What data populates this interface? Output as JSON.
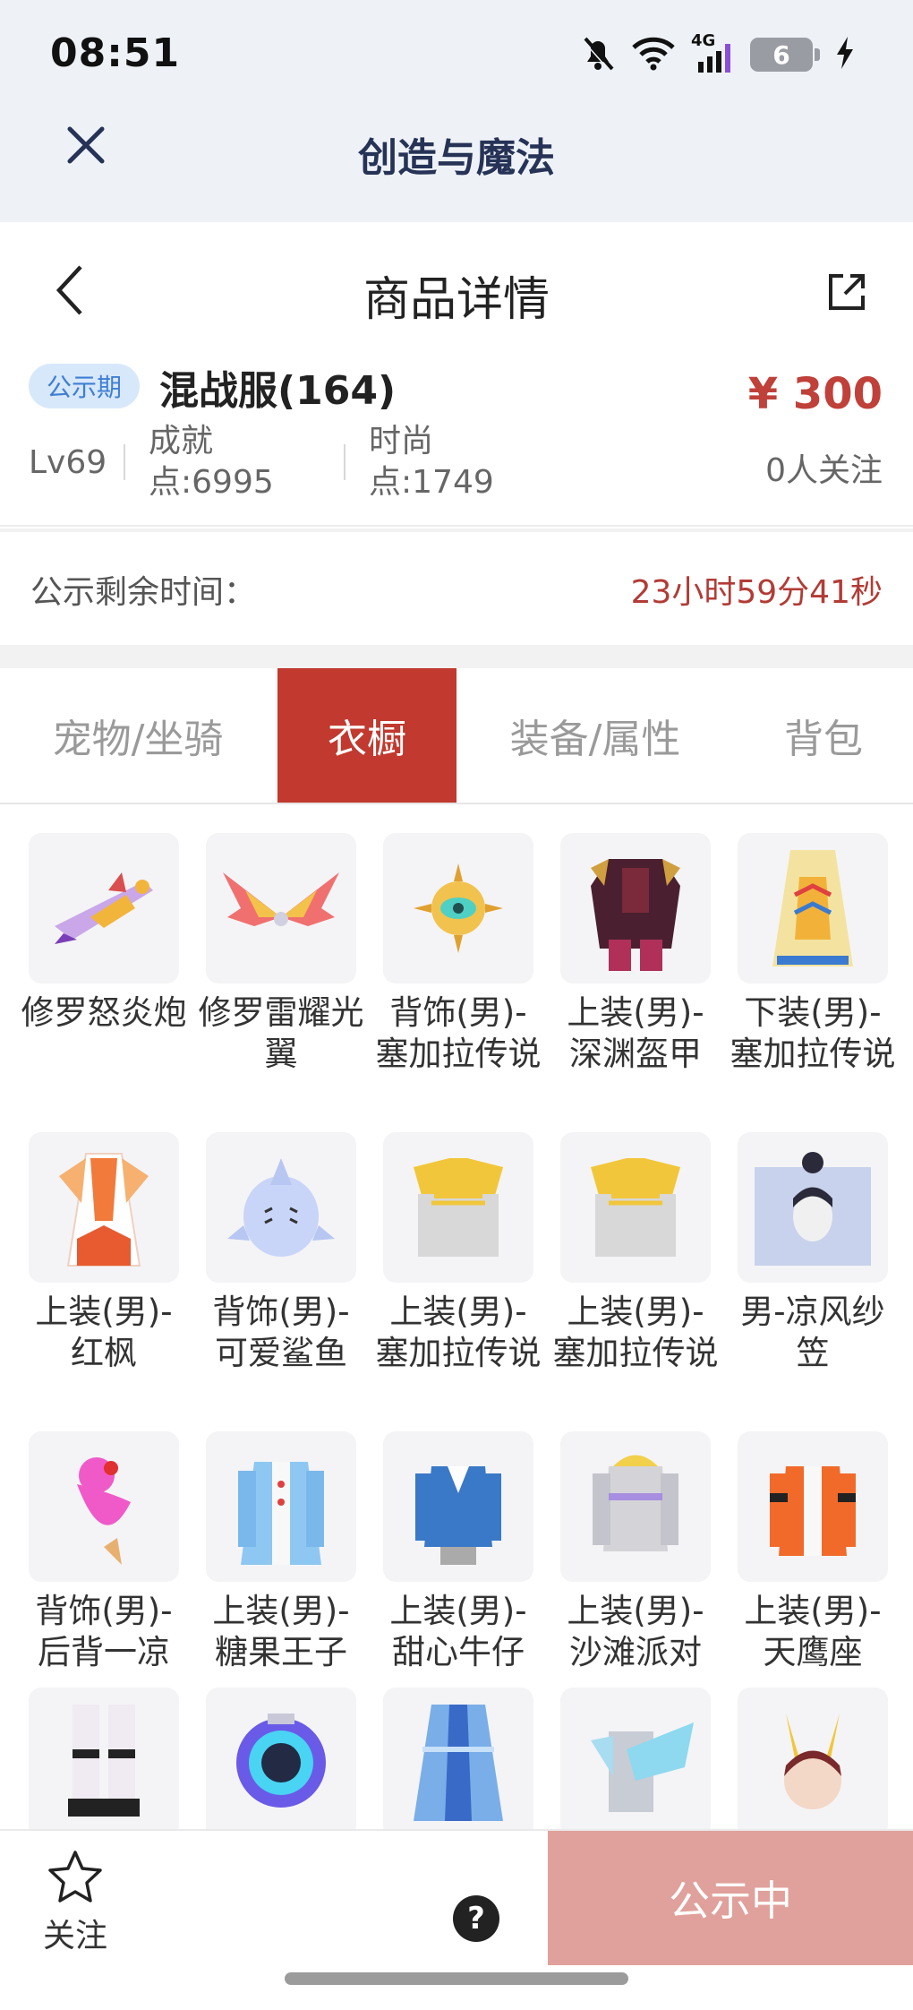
{
  "status_bar": {
    "time": "08:51",
    "network": "4G",
    "battery": "6"
  },
  "app_header": {
    "title": "创造与魔法"
  },
  "page_header": {
    "title": "商品详情"
  },
  "product": {
    "badge": "公示期",
    "name": "混战服(164)",
    "price": "¥ 300",
    "level": "Lv69",
    "achievement_label": "成就",
    "achievement_value": "点:6995",
    "fashion_label": "时尚",
    "fashion_value": "点:1749",
    "followers": "0人关注"
  },
  "timer": {
    "label": "公示剩余时间：",
    "value": "23小时59分41秒"
  },
  "tabs": [
    {
      "label": "宠物/坐骑",
      "active": false
    },
    {
      "label": "衣橱",
      "active": true
    },
    {
      "label": "装备/属性",
      "active": false
    },
    {
      "label": "背包",
      "active": false
    }
  ],
  "items": [
    {
      "label": "修罗怒炎炮",
      "icon": "cannon-icon"
    },
    {
      "label": "修罗雷耀光翼",
      "icon": "wings-icon"
    },
    {
      "label": "背饰(男)-塞加拉传说",
      "icon": "eye-ornament-icon"
    },
    {
      "label": "上装(男)-深渊盔甲",
      "icon": "armor-icon"
    },
    {
      "label": "下装(男)-塞加拉传说",
      "icon": "robe-icon"
    },
    {
      "label": "上装(男)-红枫",
      "icon": "red-robe-icon"
    },
    {
      "label": "背饰(男)-可爱鲨鱼",
      "icon": "shark-icon"
    },
    {
      "label": "上装(男)-塞加拉传说",
      "icon": "gold-shirt-icon"
    },
    {
      "label": "上装(男)-塞加拉传说",
      "icon": "gold-shirt-icon"
    },
    {
      "label": "男-凉风纱笠",
      "icon": "veil-hat-icon"
    },
    {
      "label": "背饰(男)-后背一凉",
      "icon": "ice-cream-icon"
    },
    {
      "label": "上装(男)-糖果王子",
      "icon": "prince-coat-icon"
    },
    {
      "label": "上装(男)-甜心牛仔",
      "icon": "denim-jacket-icon"
    },
    {
      "label": "上装(男)-沙滩派对",
      "icon": "hoodie-icon"
    },
    {
      "label": "上装(男)-天鹰座",
      "icon": "orange-jacket-icon"
    },
    {
      "label": "",
      "icon": "boots-icon"
    },
    {
      "label": "",
      "icon": "jetpack-icon"
    },
    {
      "label": "",
      "icon": "blue-cape-icon"
    },
    {
      "label": "",
      "icon": "wing-top-icon"
    },
    {
      "label": "",
      "icon": "horned-head-icon"
    }
  ],
  "bottom_bar": {
    "follow_label": "关注",
    "help_label": "?",
    "action_label": "公示中"
  },
  "colors": {
    "accent": "#c1392f",
    "price": "#c0403a",
    "badge_bg": "#d8e8fb",
    "action_disabled": "#e0a09b"
  }
}
